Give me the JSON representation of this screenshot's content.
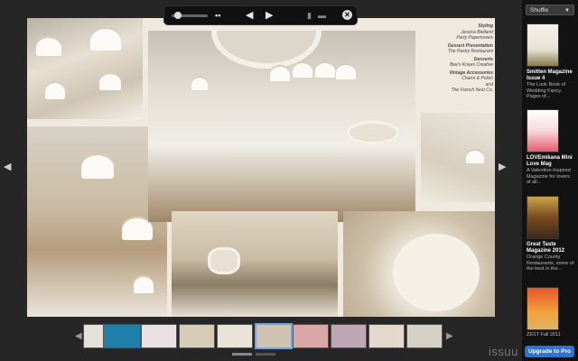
{
  "toolbar": {
    "grid_icon": "grid-icon",
    "prev_icon": "prev-page-icon",
    "next_icon": "next-page-icon",
    "close_glyph": "✕"
  },
  "spread": {
    "credits": [
      "Styling",
      "Jessica Bielland",
      "Party Papertowels",
      "Dessert Presentation",
      "The Pastry Restaurant",
      "Desserts",
      "Bee's Knees Creative",
      "Vintage Accessories",
      "Charm & Polish",
      "and",
      "The French Nest Co."
    ]
  },
  "sidebar": {
    "shuffle_label": "Shuffle",
    "items": [
      {
        "title": "Smitten Magazine Issue 4",
        "desc": "The Look Book of Wedding Fancy. Pages of..."
      },
      {
        "title": "LOVEmikana Mini Love Mag",
        "desc": "A Valentine-Inspired Magazine for lovers of all..."
      },
      {
        "title": "Great Taste Magazine 2012",
        "desc": "Orange County Restaurants, some of the best in the..."
      },
      {
        "title": "",
        "desc": "ZEST Fall 2011"
      }
    ],
    "upgrade_label": "Upgrade to Pro"
  },
  "brand": "issuu"
}
